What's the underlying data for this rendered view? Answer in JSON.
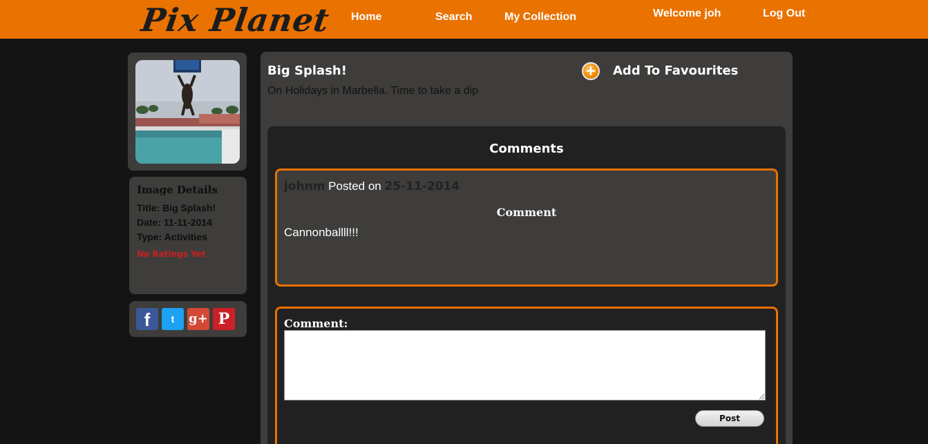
{
  "header": {
    "logo": "Pix Planet",
    "nav": [
      "Home",
      "Search",
      "My Collection"
    ],
    "welcome": "Welcome joh",
    "logout": "Log Out"
  },
  "image": {
    "title": "Big Splash!",
    "description": "On Holidays in Marbella. Time to take a dip"
  },
  "favourites_label": "Add To Favourites",
  "details": {
    "heading": "Image Details",
    "title": "Title: Big Splash!",
    "date": "Date: 11-11-2014",
    "type": "Type: Activities",
    "rating": "No Ratings Yet"
  },
  "social": {
    "facebook": "f",
    "twitter": "t",
    "googleplus": "g+",
    "pinterest": "P"
  },
  "comments": {
    "heading": "Comments",
    "items": [
      {
        "user": "johnm",
        "posted_on": "Posted on",
        "date": "25-11-2014",
        "label": "Comment",
        "text": "Cannonballll!!!"
      }
    ]
  },
  "form": {
    "label": "Comment:",
    "post_label": "Post"
  },
  "colors": {
    "accent": "#e97200",
    "panel": "#3e3d3b",
    "background": "#141414"
  }
}
